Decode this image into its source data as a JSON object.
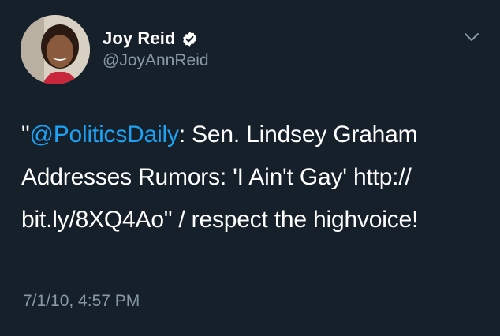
{
  "author": {
    "display_name": "Joy Reid",
    "handle": "@JoyAnnReid",
    "verified": true,
    "avatar_icon": "profile-photo"
  },
  "tweet": {
    "text_prefix": "\"",
    "mention": "@PoliticsDaily",
    "text_body": ": Sen. Lindsey Graham Addresses Rumors: 'I Ain't Gay' http:// bit.ly/8XQ4Ao\" / respect the highvoice!",
    "timestamp": "7/1/10, 4:57 PM"
  },
  "icons": {
    "verified": "verified-badge-icon",
    "menu": "chevron-down-icon"
  },
  "colors": {
    "background": "#15202b",
    "text": "#ffffff",
    "secondary": "#8899a6",
    "link": "#1da1f2"
  }
}
